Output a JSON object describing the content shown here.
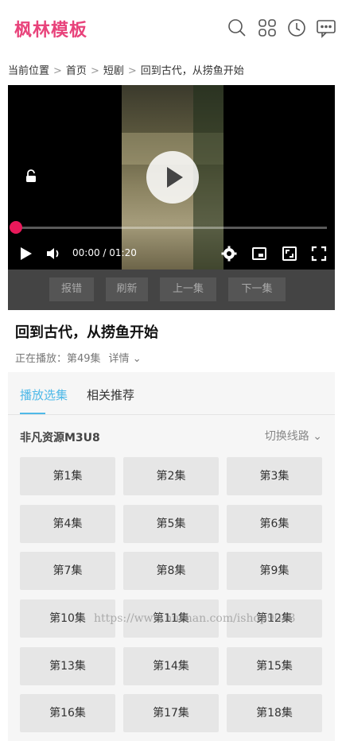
{
  "header": {
    "logo": "枫林模板",
    "icons": [
      "search-icon",
      "grid-icon",
      "clock-icon",
      "message-icon"
    ]
  },
  "breadcrumb": {
    "prefix": "当前位置",
    "items": [
      "首页",
      "短剧",
      "回到古代，从捞鱼开始"
    ]
  },
  "player": {
    "time": "00:00 / 01:20",
    "progress": 0.0
  },
  "actions": [
    "报错",
    "刷新",
    "上一集",
    "下一集"
  ],
  "show": {
    "title": "回到古代，从捞鱼开始",
    "now_playing": "正在播放：第49集",
    "detail_label": "详情"
  },
  "tabs": [
    "播放选集",
    "相关推荐"
  ],
  "source": {
    "name": "非凡资源M3U8",
    "switch_label": "切换线路"
  },
  "episodes": [
    "第1集",
    "第2集",
    "第3集",
    "第4集",
    "第5集",
    "第6集",
    "第7集",
    "第8集",
    "第9集",
    "第10集",
    "第11集",
    "第12集",
    "第13集",
    "第14集",
    "第15集",
    "第16集",
    "第17集",
    "第18集"
  ],
  "watermark": "https://www.huzhan.com/ishop9043",
  "colors": {
    "brand": "#e8437b",
    "accent": "#4fb9e8",
    "progress": "#e8195a"
  }
}
